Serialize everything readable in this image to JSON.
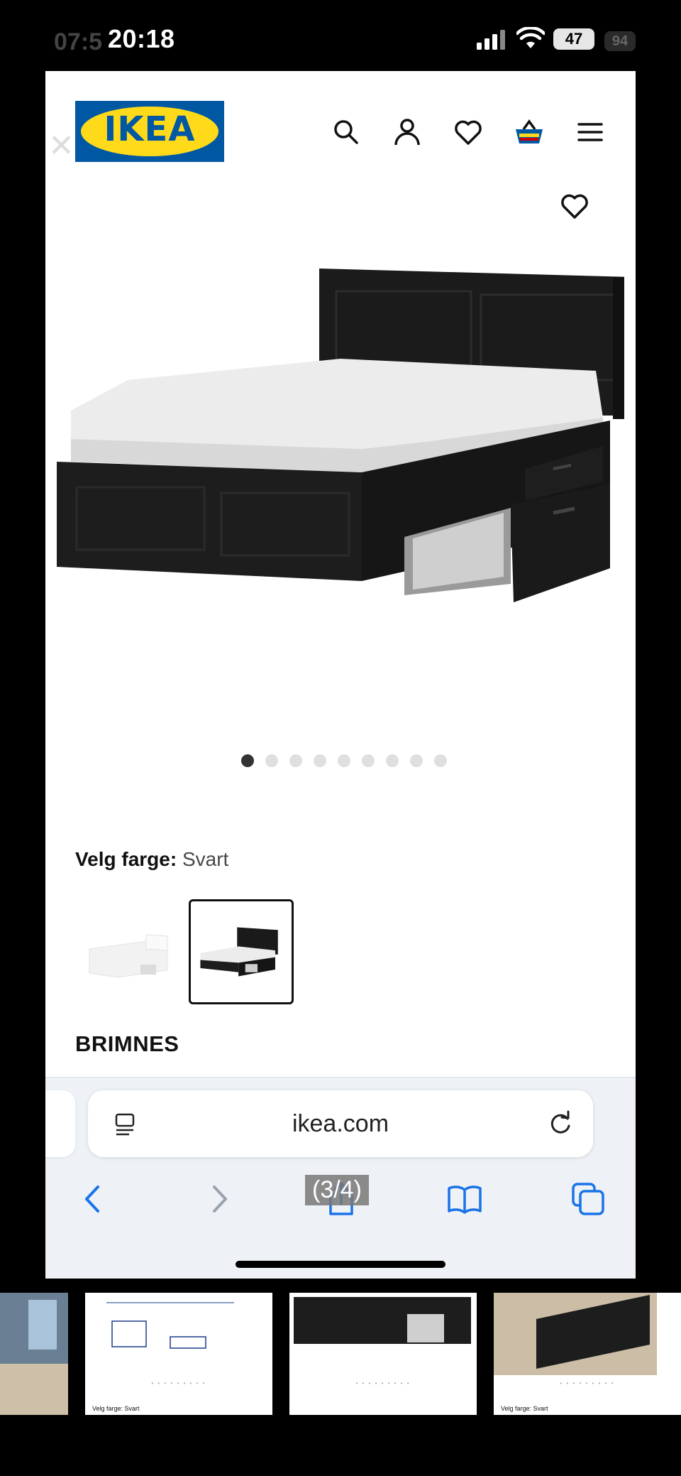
{
  "status_bar": {
    "time": "20:18",
    "ghost_time": "07:5",
    "battery": "47",
    "ghost_battery": "94"
  },
  "header": {
    "logo_text": "IKEA",
    "icons": [
      "search-icon",
      "account-icon",
      "heart-icon",
      "basket-icon",
      "menu-icon"
    ]
  },
  "carousel": {
    "total_slides": 9,
    "active_index": 0
  },
  "color_selector": {
    "label": "Velg farge:",
    "value": "Svart",
    "options": [
      "white",
      "black"
    ],
    "selected": "black"
  },
  "product": {
    "name": "BRIMNES"
  },
  "browser": {
    "url": "ikea.com"
  },
  "overlay": {
    "pager": "(3/4)"
  },
  "thumbnails": {
    "label": "Velg farge: Svart"
  }
}
